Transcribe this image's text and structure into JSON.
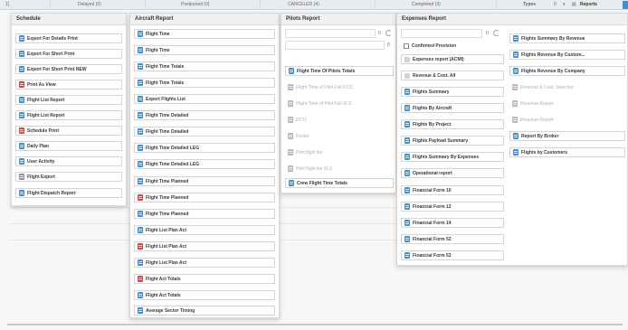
{
  "top_bar": {
    "columns": [
      {
        "label": "1)"
      },
      {
        "label": "Delayed (0)"
      },
      {
        "label": "Postponed (0)"
      },
      {
        "label": "CANCELED (4)"
      },
      {
        "label": "Completed (3)"
      }
    ],
    "types_label": "Types",
    "types_value": "0",
    "reports_label": "Reports"
  },
  "schedule": {
    "title": "Schedule",
    "items": [
      {
        "label": "Export For Details Print",
        "icon": "document-blue-icon"
      },
      {
        "label": "Export For Short Print",
        "icon": "document-blue-icon"
      },
      {
        "label": "Export For Short Print NEW",
        "icon": "document-blue-icon"
      },
      {
        "label": "Print As View",
        "icon": "pdf-red-icon"
      },
      {
        "label": "Flight List Report",
        "icon": "document-blue-icon"
      },
      {
        "label": "Flight List Report",
        "icon": "document-blue-icon"
      },
      {
        "label": "Schedule Print",
        "icon": "pdf-red-icon"
      },
      {
        "label": "Daily Plan",
        "icon": "document-blue-icon"
      },
      {
        "label": "User Activity",
        "icon": "document-blue-icon"
      },
      {
        "label": "Flight Export",
        "icon": "grid-icon"
      },
      {
        "label": "Flight Dispatch Report",
        "icon": "document-blue-icon"
      }
    ]
  },
  "aircraft": {
    "title": "Aircraft Report",
    "items": [
      {
        "label": "Flight Time",
        "icon": "document-blue-icon"
      },
      {
        "label": "Flight Time",
        "icon": "document-blue-icon"
      },
      {
        "label": "Flight Time Totals",
        "icon": "document-blue-icon"
      },
      {
        "label": "Flight Time Totals",
        "icon": "document-blue-icon"
      },
      {
        "label": "Export Flights List",
        "icon": "document-blue-icon"
      },
      {
        "label": "Flight Time Detailed",
        "icon": "document-blue-icon"
      },
      {
        "label": "Flight Time Detailed",
        "icon": "document-blue-icon"
      },
      {
        "label": "Flight Time Detailed LEG",
        "icon": "document-blue-icon"
      },
      {
        "label": "Flight Time Detailed LEG",
        "icon": "document-blue-icon"
      },
      {
        "label": "Flight Time Planned",
        "icon": "document-blue-icon"
      },
      {
        "label": "Flight Time Planned",
        "icon": "pdf-red-icon"
      },
      {
        "label": "Flight Time Planned",
        "icon": "document-blue-icon"
      },
      {
        "label": "Flight List Plan Act",
        "icon": "document-blue-icon"
      },
      {
        "label": "Flight List Plan Act",
        "icon": "pdf-red-icon"
      },
      {
        "label": "Flight List Plan Act",
        "icon": "document-blue-icon"
      },
      {
        "label": "Flight Act Totals",
        "icon": "pdf-red-icon"
      },
      {
        "label": "Flight Act Totals",
        "icon": "document-blue-icon"
      },
      {
        "label": "Average Sector Timing",
        "icon": "document-blue-icon"
      }
    ]
  },
  "pilots": {
    "title": "Pilots Report",
    "select_value": "0",
    "number_value": "0",
    "items": [
      {
        "label": "Flight Time Of Pilots Totals",
        "icon": "document-blue-icon",
        "enabled": true
      },
      {
        "label": "Flight Time of Pilot Full DOC",
        "icon": "document-gray-icon",
        "enabled": false
      },
      {
        "label": "Flight Time of Pilot Full XLS",
        "icon": "document-gray-icon",
        "enabled": false
      },
      {
        "label": "FDTL",
        "icon": "document-gray-icon",
        "enabled": false
      },
      {
        "label": "Roster",
        "icon": "document-gray-icon",
        "enabled": false
      },
      {
        "label": "Pilot flight list",
        "icon": "grid-gray-icon",
        "enabled": false
      },
      {
        "label": "Pilot flight list XLS",
        "icon": "grid-gray-icon",
        "enabled": false
      },
      {
        "label": "Crew Flight Time Totals",
        "icon": "document-blue-icon",
        "enabled": true
      }
    ]
  },
  "expenses": {
    "title": "Expenses Report",
    "select_value": "0",
    "checkbox_label": "Confirmed Provision",
    "left_items": [
      {
        "label": "Expenses report (ACMI)",
        "icon": "expense-icon"
      },
      {
        "label": "Revenue & Cost. All",
        "icon": "expense-icon"
      },
      {
        "label": "Flights Summary",
        "icon": "document-blue-icon"
      },
      {
        "label": "Flights By Aircraft",
        "icon": "document-blue-icon"
      },
      {
        "label": "Flights By Project",
        "icon": "document-blue-icon"
      },
      {
        "label": "Flights Payload Summary",
        "icon": "document-blue-icon"
      },
      {
        "label": "Flights Summary By Expenses",
        "icon": "document-blue-icon"
      },
      {
        "label": "Operational report",
        "icon": "document-blue-icon"
      },
      {
        "label": "Financial Form 10",
        "icon": "document-blue-icon"
      },
      {
        "label": "Financial Form 12",
        "icon": "document-blue-icon"
      },
      {
        "label": "Financial Form 14",
        "icon": "document-blue-icon"
      },
      {
        "label": "Financial Form 52",
        "icon": "document-blue-icon"
      },
      {
        "label": "Financial Form 53",
        "icon": "document-blue-icon"
      }
    ],
    "right_items": [
      {
        "label": "Flights Summary By Revenue",
        "icon": "document-blue-icon",
        "enabled": true
      },
      {
        "label": "Flights Revenue By Custom...",
        "icon": "document-blue-icon",
        "enabled": true
      },
      {
        "label": "Flights Revenue By Company",
        "icon": "document-blue-icon",
        "enabled": true
      },
      {
        "label": "Revenue & Cost. Selected",
        "icon": "expense-gray-icon",
        "enabled": false
      },
      {
        "label": "Revenue Report",
        "icon": "expense-gray-icon",
        "enabled": false
      },
      {
        "label": "Revenue Report",
        "icon": "document-gray-icon",
        "enabled": false
      },
      {
        "label": "Report By Broker",
        "icon": "document-blue-icon",
        "enabled": true
      },
      {
        "label": "Flights by Customers",
        "icon": "document-blue-icon",
        "enabled": true
      }
    ]
  },
  "colors": {
    "accent_blue": "#3d8fd6",
    "pdf_red": "#d9463e",
    "disabled_text": "#a9b0b8"
  }
}
